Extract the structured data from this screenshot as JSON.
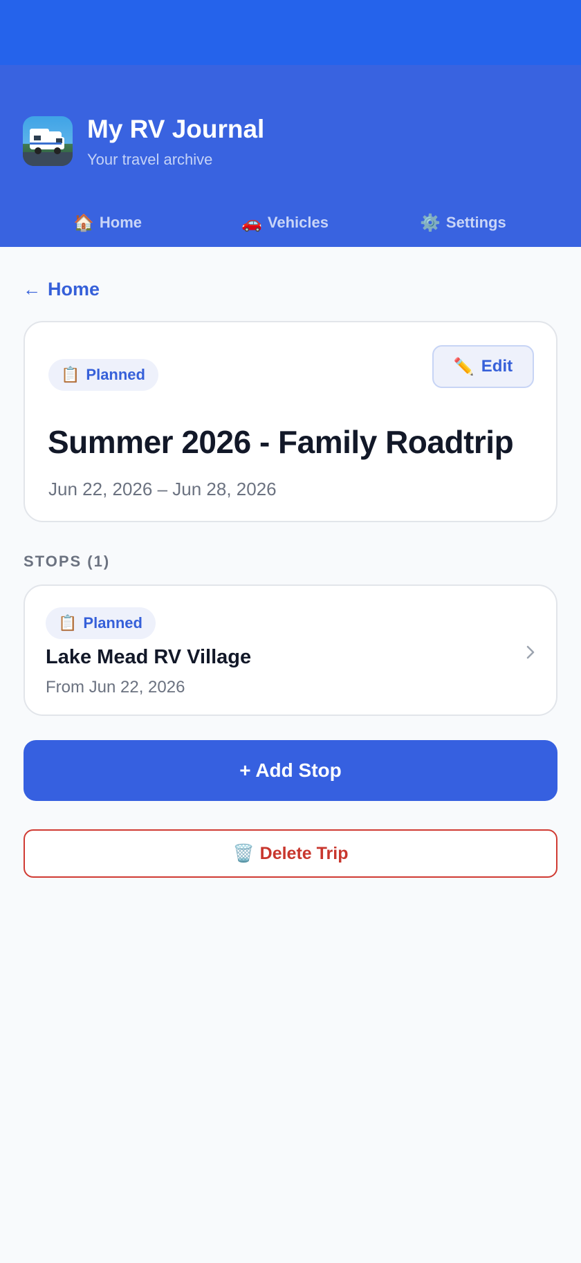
{
  "app": {
    "title": "My RV Journal",
    "subtitle": "Your travel archive",
    "logo_icon": "rv-camper-icon"
  },
  "nav": [
    {
      "icon": "🏠",
      "label": "Home"
    },
    {
      "icon": "🚗",
      "label": "Vehicles"
    },
    {
      "icon": "⚙️",
      "label": "Settings"
    }
  ],
  "back": {
    "arrow": "←",
    "label": "Home"
  },
  "trip": {
    "status_icon": "📋",
    "status": "Planned",
    "edit_icon": "✏️",
    "edit_label": "Edit",
    "title": "Summer 2026 - Family Roadtrip",
    "dates": "Jun 22, 2026 – Jun 28, 2026"
  },
  "stops_section": {
    "label": "STOPS (1)"
  },
  "stops": [
    {
      "status_icon": "📋",
      "status": "Planned",
      "name": "Lake Mead RV Village",
      "date": "From Jun 22, 2026"
    }
  ],
  "actions": {
    "add_stop": "+ Add Stop",
    "delete_icon": "🗑️",
    "delete_trip": "Delete Trip"
  },
  "colors": {
    "status_bar": "#2563eb",
    "header": "#3963e0",
    "accent": "#3660d9",
    "danger": "#c8362d",
    "background": "#f8fafc"
  }
}
